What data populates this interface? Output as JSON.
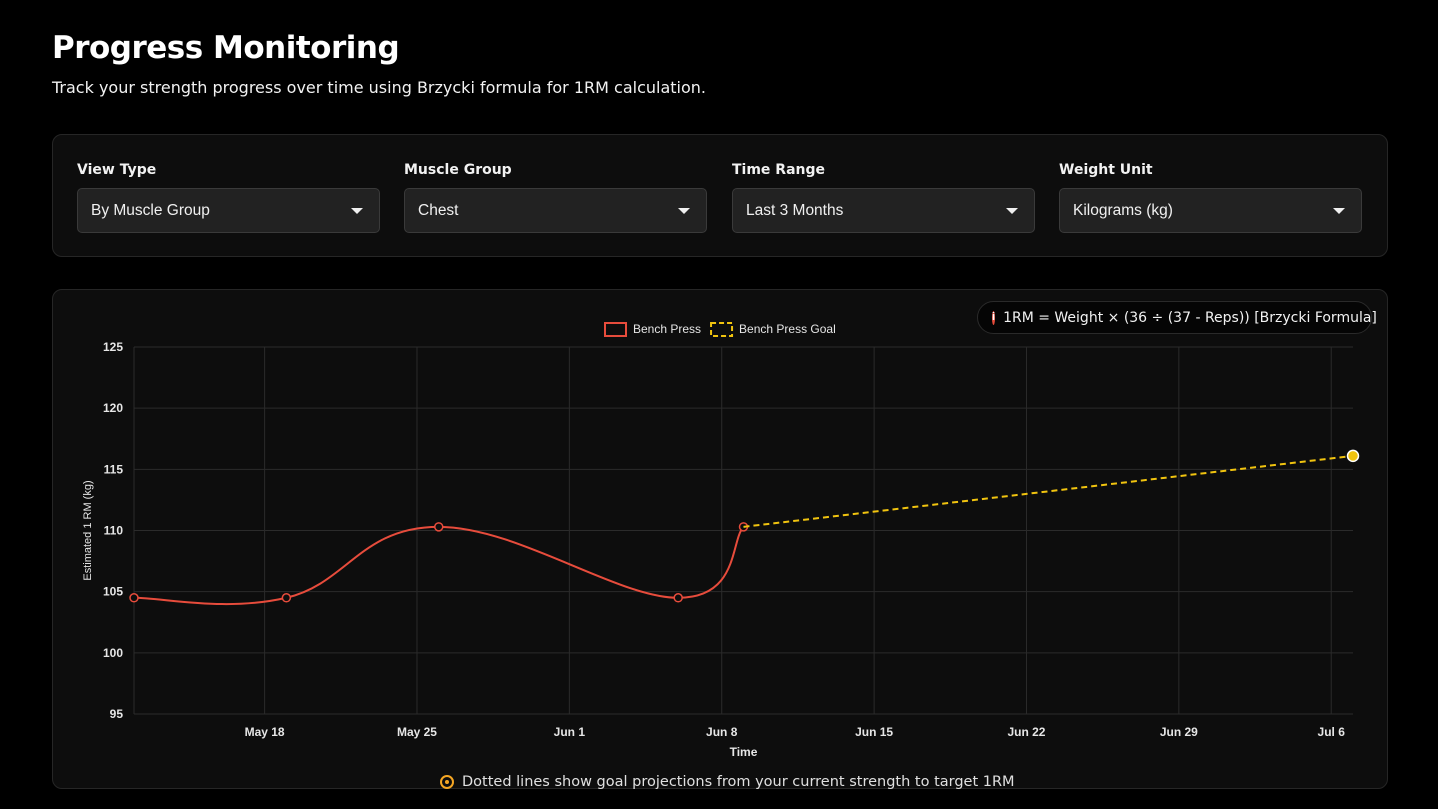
{
  "header": {
    "title": "Progress Monitoring",
    "subtitle": "Track your strength progress over time using Brzycki formula for 1RM calculation."
  },
  "filters": {
    "view_type": {
      "label": "View Type",
      "value": "By Muscle Group"
    },
    "muscle_group": {
      "label": "Muscle Group",
      "value": "Chest"
    },
    "time_range": {
      "label": "Time Range",
      "value": "Last 3 Months"
    },
    "weight_unit": {
      "label": "Weight Unit",
      "value": "Kilograms (kg)"
    }
  },
  "formula_badge": {
    "icon": "info-icon",
    "text": "1RM = Weight × (36 ÷ (37 - Reps)) [Brzycki Formula]"
  },
  "footer": {
    "icon": "target-icon",
    "text": "Dotted lines show goal projections from your current strength to target 1RM"
  },
  "chart_data": {
    "type": "line",
    "xlabel": "Time",
    "ylabel": "Estimated 1 RM  (kg)",
    "ylim": [
      95,
      125
    ],
    "y_ticks": [
      "95",
      "100",
      "105",
      "110",
      "115",
      "120",
      "125"
    ],
    "x_ticks": [
      "May 18",
      "May 25",
      "Jun 1",
      "Jun 8",
      "Jun 15",
      "Jun 22",
      "Jun 29",
      "Jul 6"
    ],
    "x_range": [
      "2025-05-12",
      "2025-07-07"
    ],
    "grid": true,
    "legend_position": "top",
    "series": [
      {
        "name": "Bench Press",
        "color": "#e74c3c",
        "style": "solid",
        "points": [
          {
            "x": "2025-05-12",
            "y": 104.5
          },
          {
            "x": "2025-05-19",
            "y": 104.5
          },
          {
            "x": "2025-05-26",
            "y": 110.3
          },
          {
            "x": "2025-06-06",
            "y": 104.5
          },
          {
            "x": "2025-06-09",
            "y": 110.3
          }
        ]
      },
      {
        "name": "Bench Press Goal",
        "color": "#f1c40f",
        "style": "dashed",
        "points": [
          {
            "x": "2025-06-09",
            "y": 110.3
          },
          {
            "x": "2025-07-07",
            "y": 116.1
          }
        ]
      }
    ]
  }
}
